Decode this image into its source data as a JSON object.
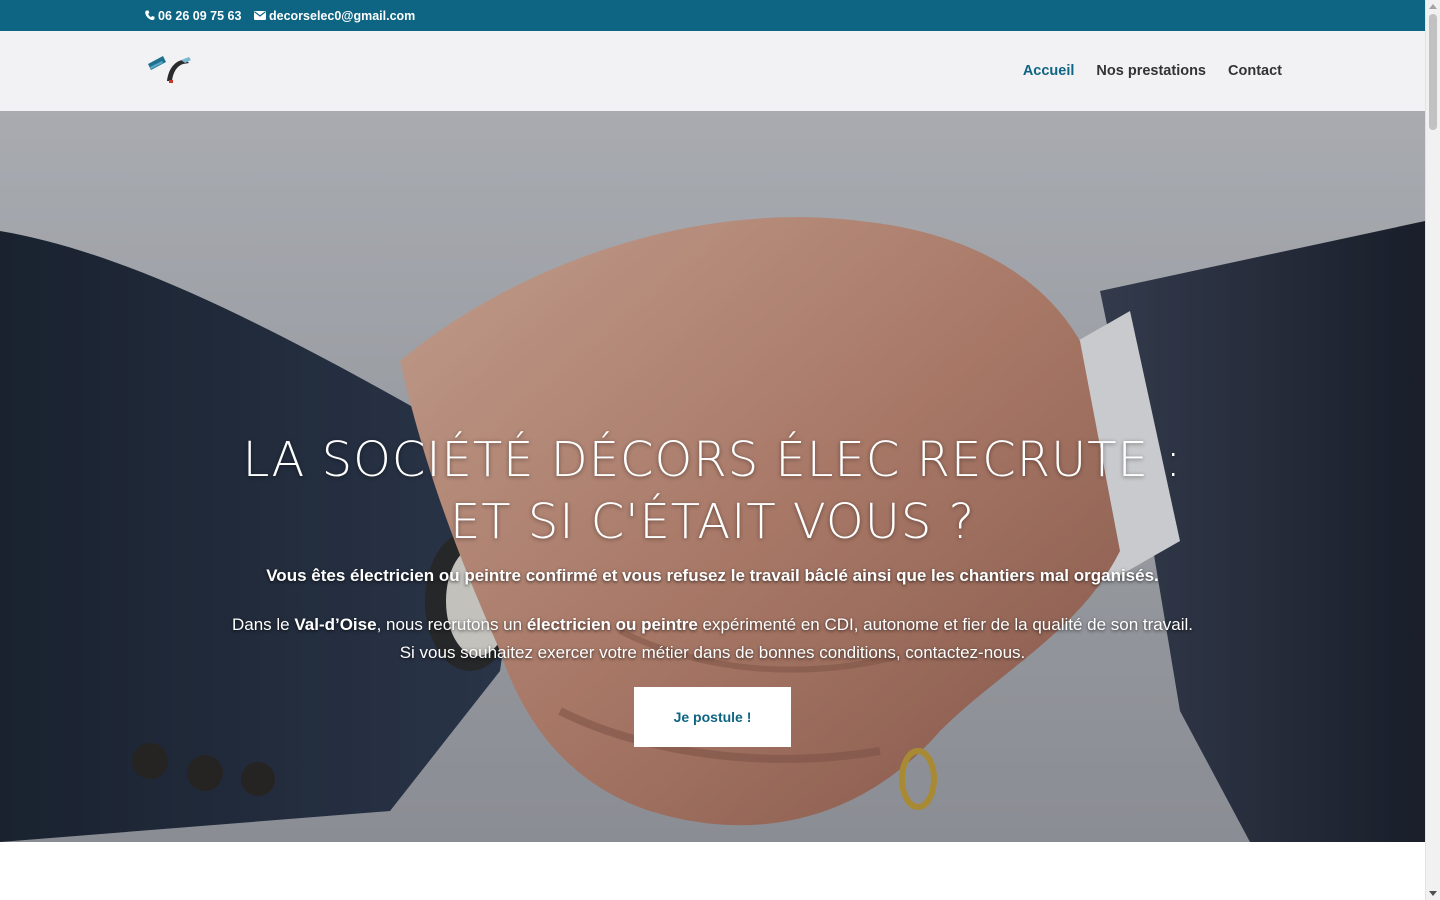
{
  "topbar": {
    "phone": "06 26 09 75 63",
    "email": "decorselec0@gmail.com",
    "background": "#0e6583"
  },
  "header": {
    "logo_icon": "decors-elec-logo",
    "nav": {
      "home": "Accueil",
      "services": "Nos prestations",
      "contact": "Contact"
    },
    "active_color": "#0e6583"
  },
  "hero": {
    "title_line1": "LA SOCIÉTÉ DÉCORS ÉLEC RECRUTE :",
    "title_line2": "ET SI C'ÉTAIT VOUS ?",
    "subtitle": "Vous êtes électricien ou peintre confirmé et vous refusez le travail bâclé ainsi que les chantiers mal organisés.",
    "text": {
      "p1_a": "Dans le ",
      "p1_region": "Val-d’Oise",
      "p1_b": ", nous recrutons un ",
      "p1_job": "électricien ou peintre",
      "p1_c": " expérimenté en CDI, autonome et fier de la qualité de son travail.",
      "p2": "Si vous souhaitez exercer votre métier dans de bonnes conditions, contactez-nous."
    },
    "cta_label": "Je postule !",
    "slides_count": 4,
    "active_slide": 1
  }
}
